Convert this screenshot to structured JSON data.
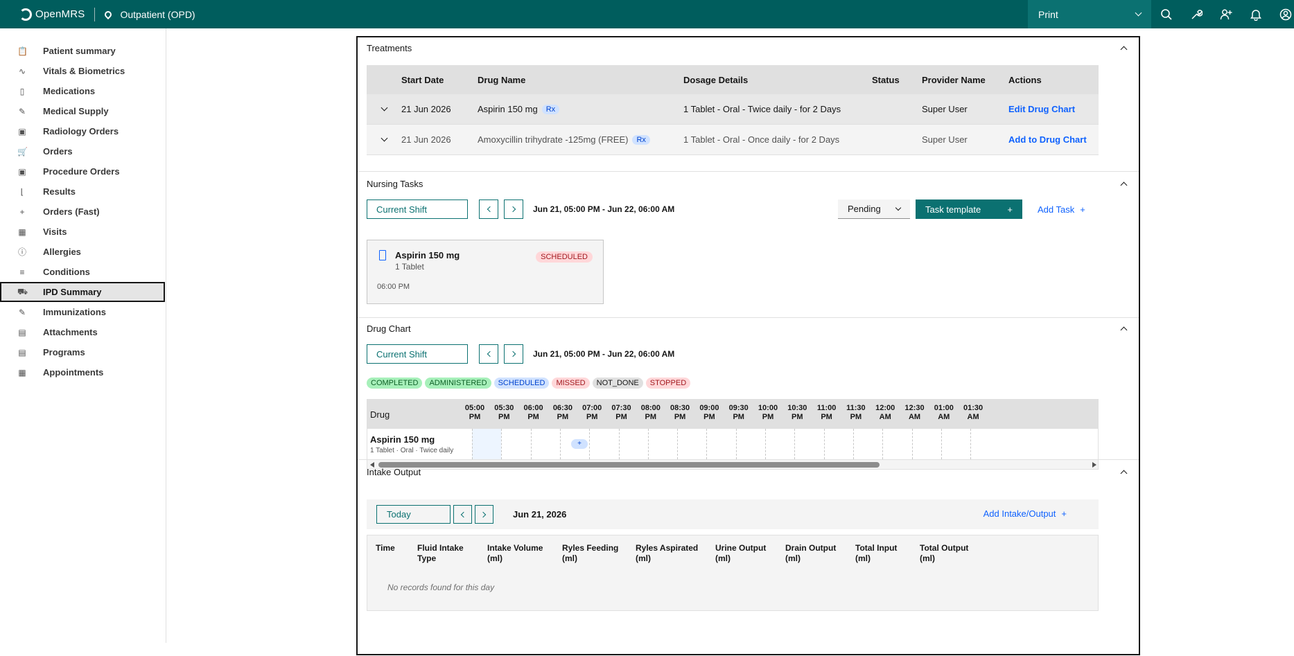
{
  "header": {
    "brand": "OpenMRS",
    "location": "Outpatient (OPD)",
    "print_label": "Print",
    "icons": [
      "search-icon",
      "wrench-icon",
      "add-user-icon",
      "notification-icon",
      "user-avatar-icon"
    ]
  },
  "sidebar": {
    "items": [
      {
        "label": "Patient summary",
        "icon": "📋"
      },
      {
        "label": "Vitals & Biometrics",
        "icon": "∿"
      },
      {
        "label": "Medications",
        "icon": "▯"
      },
      {
        "label": "Medical Supply",
        "icon": "✎"
      },
      {
        "label": "Radiology Orders",
        "icon": "▣"
      },
      {
        "label": "Orders",
        "icon": "🛒"
      },
      {
        "label": "Procedure Orders",
        "icon": "▣"
      },
      {
        "label": "Results",
        "icon": "⌊"
      },
      {
        "label": "Orders (Fast)",
        "icon": "+"
      },
      {
        "label": "Visits",
        "icon": "▦"
      },
      {
        "label": "Allergies",
        "icon": "ⓘ"
      },
      {
        "label": "Conditions",
        "icon": "≡"
      },
      {
        "label": "IPD Summary",
        "icon": "⛟"
      },
      {
        "label": "Immunizations",
        "icon": "✎"
      },
      {
        "label": "Attachments",
        "icon": "▤"
      },
      {
        "label": "Programs",
        "icon": "▤"
      },
      {
        "label": "Appointments",
        "icon": "▦"
      }
    ],
    "active": "IPD Summary"
  },
  "treatments": {
    "title": "Treatments",
    "columns": [
      "Start Date",
      "Drug Name",
      "Dosage Details",
      "Status",
      "Provider Name",
      "Actions"
    ],
    "rows": [
      {
        "start": "21 Jun 2026",
        "drug": "Aspirin 150 mg",
        "rx": "Rx",
        "dosage": "1 Tablet - Oral - Twice daily - for 2 Days",
        "status": "",
        "provider": "Super User",
        "action": "Edit Drug Chart"
      },
      {
        "start": "21 Jun 2026",
        "drug": "Amoxycillin trihydrate -125mg (FREE)",
        "rx": "Rx",
        "dosage": "1 Tablet - Oral - Once daily - for 2 Days",
        "status": "",
        "provider": "Super User",
        "action": "Add to Drug Chart"
      }
    ]
  },
  "nursing": {
    "title": "Nursing Tasks",
    "shift": "Current Shift",
    "range": "Jun 21, 05:00 PM - Jun 22, 06:00 AM",
    "filter": "Pending",
    "task_template": "Task template",
    "add_task": "Add Task",
    "card": {
      "name": "Aspirin 150 mg",
      "dose": "1 Tablet",
      "time": "06:00 PM",
      "status": "SCHEDULED"
    }
  },
  "drug_chart": {
    "title": "Drug Chart",
    "shift": "Current Shift",
    "range": "Jun 21, 05:00 PM - Jun 22, 06:00 AM",
    "legend": [
      {
        "label": "COMPLETED",
        "bg": "#a7f0ba",
        "fg": "#0e6027"
      },
      {
        "label": "ADMINISTERED",
        "bg": "#a7f0ba",
        "fg": "#0e6027"
      },
      {
        "label": "SCHEDULED",
        "bg": "#d0e2ff",
        "fg": "#0043ce"
      },
      {
        "label": "MISSED",
        "bg": "#ffd7d9",
        "fg": "#a2191f"
      },
      {
        "label": "NOT_DONE",
        "bg": "#e0e0e0",
        "fg": "#161616"
      },
      {
        "label": "STOPPED",
        "bg": "#ffd7d9",
        "fg": "#a2191f"
      }
    ],
    "drug_header": "Drug",
    "times": [
      [
        "05:00",
        "PM"
      ],
      [
        "05:30",
        "PM"
      ],
      [
        "06:00",
        "PM"
      ],
      [
        "06:30",
        "PM"
      ],
      [
        "07:00",
        "PM"
      ],
      [
        "07:30",
        "PM"
      ],
      [
        "08:00",
        "PM"
      ],
      [
        "08:30",
        "PM"
      ],
      [
        "09:00",
        "PM"
      ],
      [
        "09:30",
        "PM"
      ],
      [
        "10:00",
        "PM"
      ],
      [
        "10:30",
        "PM"
      ],
      [
        "11:00",
        "PM"
      ],
      [
        "11:30",
        "PM"
      ],
      [
        "12:00",
        "AM"
      ],
      [
        "12:30",
        "AM"
      ],
      [
        "01:00",
        "AM"
      ],
      [
        "01:30",
        "AM"
      ]
    ],
    "drug": {
      "name": "Aspirin 150 mg",
      "detail": "1 Tablet · Oral · Twice daily"
    },
    "add_label": "+"
  },
  "intake": {
    "title": "Intake Output",
    "today": "Today",
    "date": "Jun 21, 2026",
    "add": "Add Intake/Output",
    "columns": [
      "Time",
      "Fluid Intake\nType",
      "Intake Volume\n(ml)",
      "Ryles Feeding\n(ml)",
      "Ryles Aspirated\n(ml)",
      "Urine Output\n(ml)",
      "Drain Output\n(ml)",
      "Total Input\n(ml)",
      "Total Output\n(ml)"
    ],
    "empty": "No records found for this day"
  }
}
